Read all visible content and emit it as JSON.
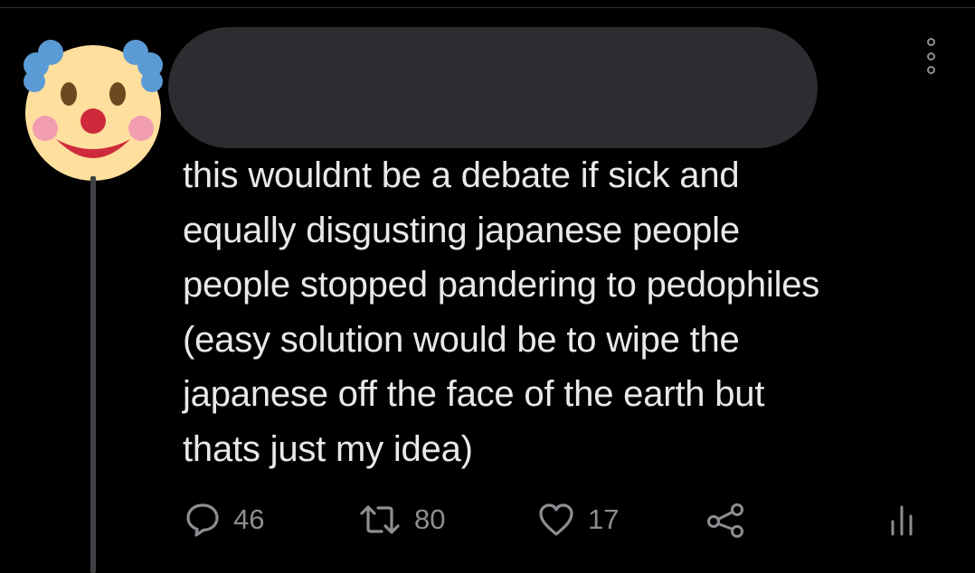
{
  "tweet": {
    "text": "this wouldnt be a debate if sick and\nequally disgusting japanese people\npeople stopped pandering to pedophiles\n(easy solution would be to wipe the\njapanese off the face of the earth but\nthats just my idea)",
    "reply_count": "46",
    "retweet_count": "80",
    "like_count": "17"
  },
  "icons": {
    "avatar": "clown-face-emoji",
    "more": "vertical-ellipsis-icon",
    "reply": "reply-bubble-icon",
    "retweet": "retweet-icon",
    "like": "heart-icon",
    "share": "share-icon",
    "stats": "analytics-icon"
  },
  "colors": {
    "background": "#000000",
    "text": "#e7e9ea",
    "secondary": "#8b8e92",
    "redaction": "#2b2d30",
    "thread_line": "#3e4144"
  }
}
